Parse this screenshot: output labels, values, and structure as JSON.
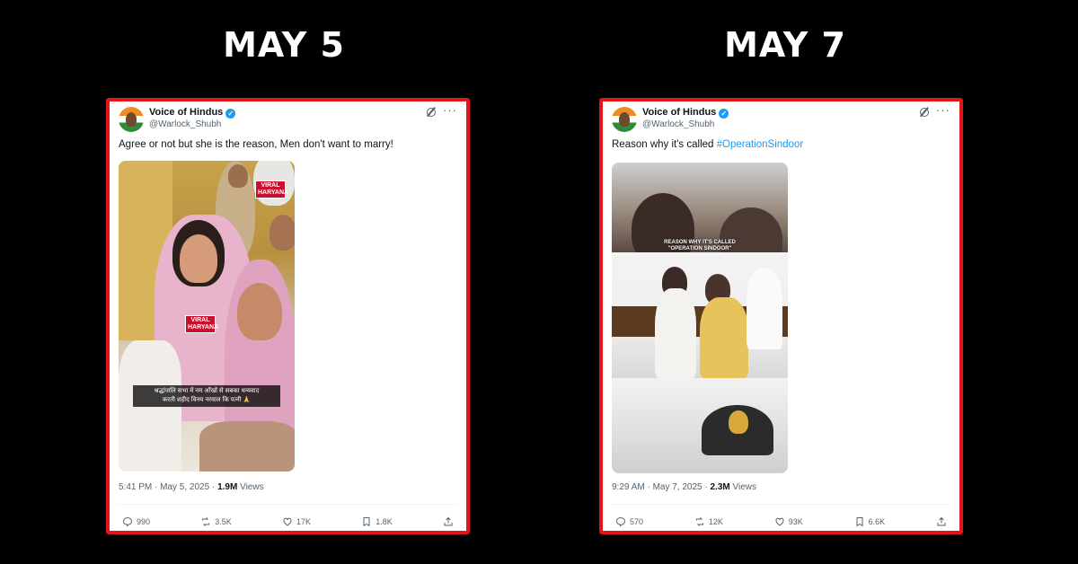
{
  "headings": {
    "left": "MAY 5",
    "right": "MAY 7"
  },
  "colors": {
    "frame": "#e3151a",
    "link": "#1d9bf0",
    "background": "#000000"
  },
  "posts": [
    {
      "display_name": "Voice of Hindus",
      "handle": "@Warlock_Shubh",
      "text": "Agree or not but she is the reason, Men don't want to marry!",
      "media": {
        "badge_top": "VIRAL HARYANA",
        "badge_mic": "VIRAL HARYANA",
        "caption_line1": "श्रद्धांजलि सभा में नम आँखों से सबका धन्यवाद",
        "caption_line2": "करती शहीद विनय नरवाल कि पत्नी 🙏"
      },
      "time": "5:41 PM · May 5, 2025 · ",
      "views_count": "1.9M",
      "views_label": " Views",
      "stats": {
        "replies": "990",
        "reposts": "3.5K",
        "likes": "17K",
        "bookmarks": "1.8K"
      }
    },
    {
      "display_name": "Voice of Hindus",
      "handle": "@Warlock_Shubh",
      "text": "Reason why it's called ",
      "hashtag": "#OperationSindoor",
      "media": {
        "overlay_line1": "REASON WHY IT'S CALLED",
        "overlay_line2": "\"OPERATION SINDOOR\""
      },
      "time": "9:29 AM · May 7, 2025 · ",
      "views_count": "2.3M",
      "views_label": " Views",
      "stats": {
        "replies": "570",
        "reposts": "12K",
        "likes": "93K",
        "bookmarks": "6.6K"
      }
    }
  ]
}
